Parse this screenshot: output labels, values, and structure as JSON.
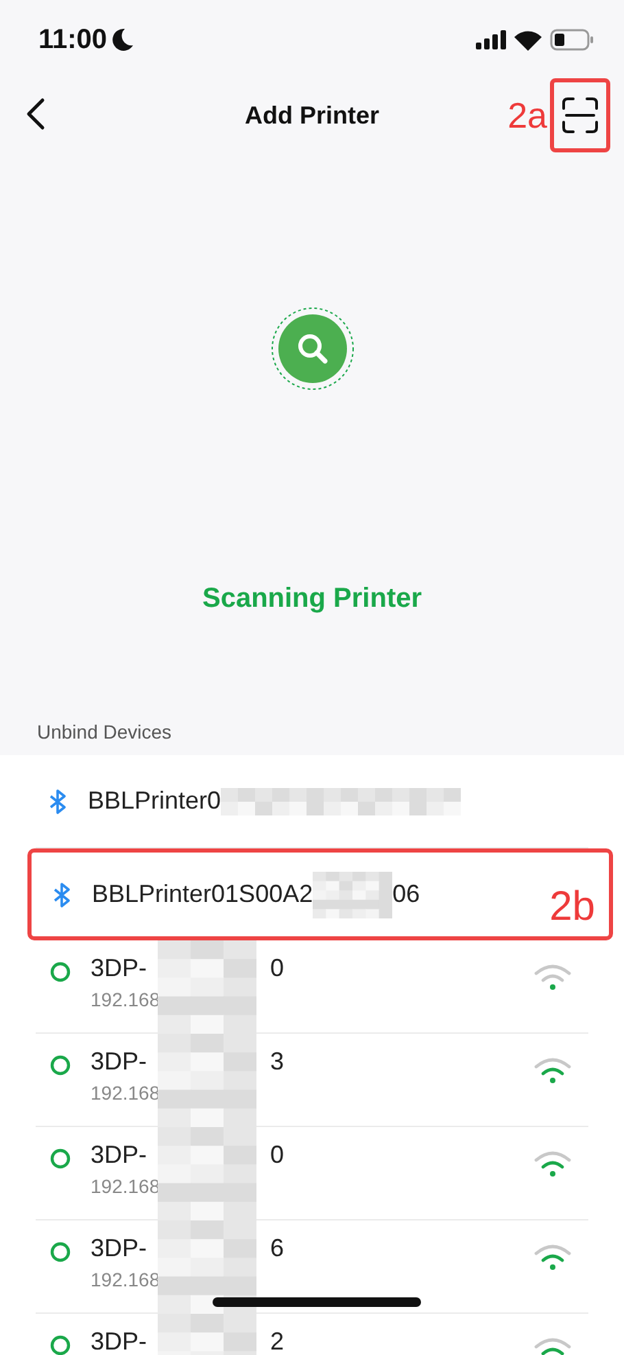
{
  "status_bar": {
    "time": "11:00"
  },
  "nav": {
    "title": "Add Printer",
    "annotation": "2a"
  },
  "scan": {
    "label": "Scanning Printer"
  },
  "section": {
    "title": "Unbind Devices"
  },
  "devices": [
    {
      "kind": "bluetooth",
      "name_start": "BBLPrinter0",
      "redacted": true
    },
    {
      "kind": "bluetooth",
      "name_start": "BBLPrinter01S00A2",
      "redacted": true,
      "name_end": "06",
      "annotation": "2b"
    },
    {
      "kind": "wifi",
      "name_start": "3DP-",
      "redacted": true,
      "name_end": "0",
      "ip": "192.168",
      "weak_signal": true
    },
    {
      "kind": "wifi",
      "name_start": "3DP-",
      "redacted": true,
      "name_end": "3",
      "ip": "192.168",
      "weak_signal": false
    },
    {
      "kind": "wifi",
      "name_start": "3DP-",
      "redacted": true,
      "name_end": "0",
      "ip": "192.168",
      "weak_signal": false
    },
    {
      "kind": "wifi",
      "name_start": "3DP-",
      "redacted": true,
      "name_end": "6",
      "ip": "192.168",
      "weak_signal": false
    },
    {
      "kind": "wifi",
      "name_start": "3DP-",
      "redacted": true,
      "name_end": "2",
      "weak_signal": false
    }
  ]
}
